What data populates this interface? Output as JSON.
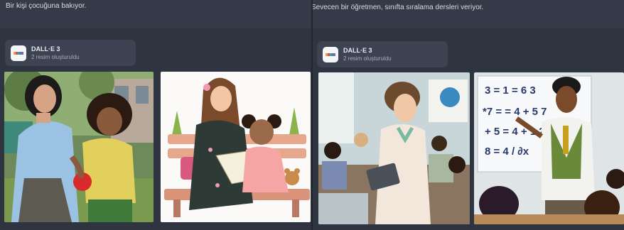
{
  "conversations": [
    {
      "prompt": "Bir kişi çocuğuna bakıyor.",
      "tool": {
        "name": "DALL·E 3",
        "subtitle": "2 resim oluşturuldu",
        "logo_colors": [
          "#e6a23c",
          "#d94f4f",
          "#4a90d9",
          "#3a9a5b",
          "#8a5cc7"
        ]
      },
      "images": [
        {
          "name": "generated-image-1",
          "subject": "woman and curly-haired child playing with a red ball outdoors"
        },
        {
          "name": "generated-image-2",
          "subject": "cartoon mother reading a book to a daughter on a park bench"
        }
      ]
    },
    {
      "prompt": "Sevecen bir öğretmen, sınıfta sıralama dersleri veriyor.",
      "tool": {
        "name": "DALL·E 3",
        "subtitle": "2 resim oluşturuldu",
        "logo_colors": [
          "#e6a23c",
          "#d94f4f",
          "#4a90d9",
          "#3a9a5b",
          "#8a5cc7"
        ]
      },
      "images": [
        {
          "name": "generated-image-3",
          "subject": "teacher with a tablet in a classroom full of students"
        },
        {
          "name": "generated-image-4",
          "subject": "cartoon teacher pointing at math equations on a whiteboard"
        }
      ],
      "whiteboard_lines": [
        "3 = 1 = 6 3",
        "*7 = = 4 + 5 7",
        "+ 5 = 4 + 1 2",
        "8 = 4 / ∂x"
      ]
    }
  ]
}
